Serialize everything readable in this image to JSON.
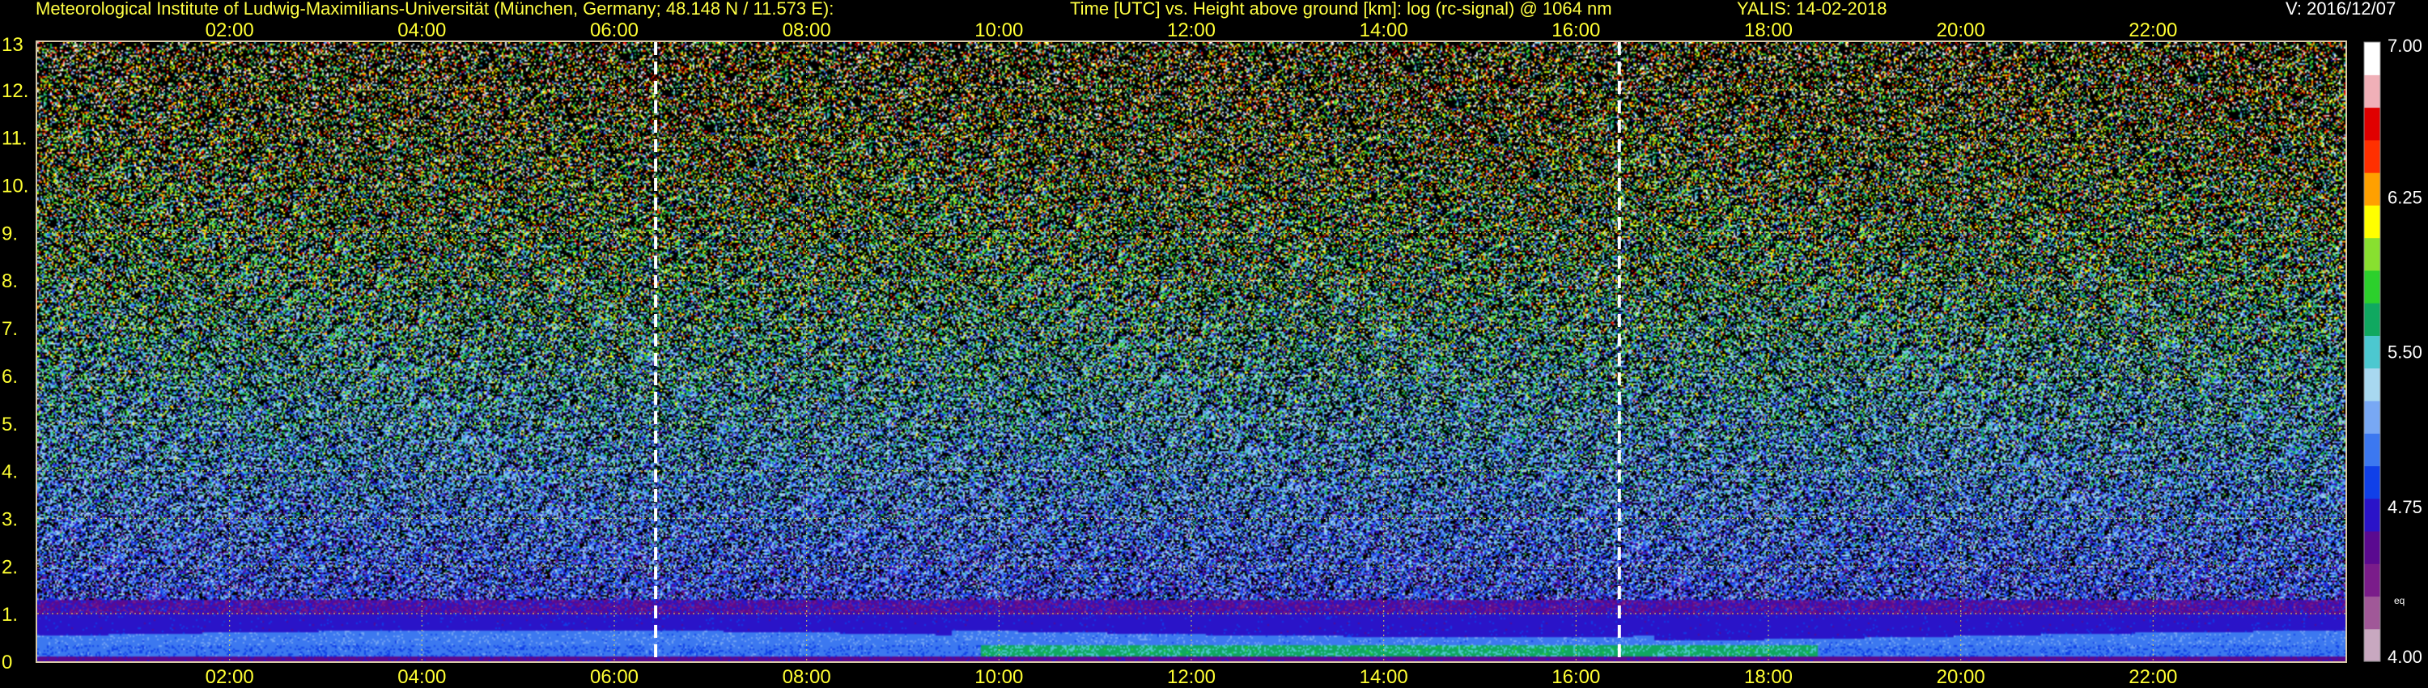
{
  "header": {
    "institute": "Meteorological Institute of Ludwig-Maximilians-Universität (München, Germany; 48.148 N / 11.573 E):",
    "axes_title": "Time [UTC] vs. Height above ground [km]: log (rc-signal) @ 1064 nm",
    "instrument_date": "YALIS: 14-02-2018",
    "version": "V: 2016/12/07"
  },
  "colors": {
    "header_text": "#ffff44",
    "tick_text": "#ffff33",
    "grid": "#e8e050",
    "marker_line": "#ffffff"
  },
  "chart_data": {
    "type": "heatmap",
    "title": "log (rc-signal) @ 1064 nm",
    "xlabel": "Time [UTC]",
    "ylabel": "Height above ground [km]",
    "xlim": [
      0,
      24
    ],
    "ylim": [
      0,
      13
    ],
    "x_ticks": [
      2,
      4,
      6,
      8,
      10,
      12,
      14,
      16,
      18,
      20,
      22
    ],
    "x_tick_labels": [
      "02:00",
      "04:00",
      "06:00",
      "08:00",
      "10:00",
      "12:00",
      "14:00",
      "16:00",
      "18:00",
      "20:00",
      "22:00"
    ],
    "y_ticks": [
      0,
      1,
      2,
      3,
      4,
      5,
      6,
      7,
      8,
      9,
      10,
      11,
      12,
      13
    ],
    "y_tick_labels": [
      "0",
      "1.",
      "2.",
      "3.",
      "4.",
      "5.",
      "6.",
      "7.",
      "8.",
      "9.",
      "10.",
      "11.",
      "12.",
      "13"
    ],
    "grid": true,
    "vertical_markers_utc": [
      6.43,
      16.45
    ],
    "colorbar": {
      "min": 4.0,
      "max": 7.0,
      "tick_values": [
        4.0,
        4.75,
        5.5,
        6.25,
        7.0
      ],
      "tick_labels": [
        "4.00",
        "4.75",
        "5.50",
        "6.25",
        "7.00"
      ],
      "extra_label": "eq",
      "colors": [
        "#c8a8c0",
        "#a05898",
        "#7a1c8a",
        "#5a0a90",
        "#2a14c8",
        "#1040e8",
        "#3c78f0",
        "#78a8f4",
        "#a8d8f0",
        "#4cc8d0",
        "#10a860",
        "#2cd02c",
        "#88e030",
        "#ffff00",
        "#ffa000",
        "#ff3000",
        "#e00000",
        "#f0b0b8",
        "#ffffff"
      ]
    }
  }
}
